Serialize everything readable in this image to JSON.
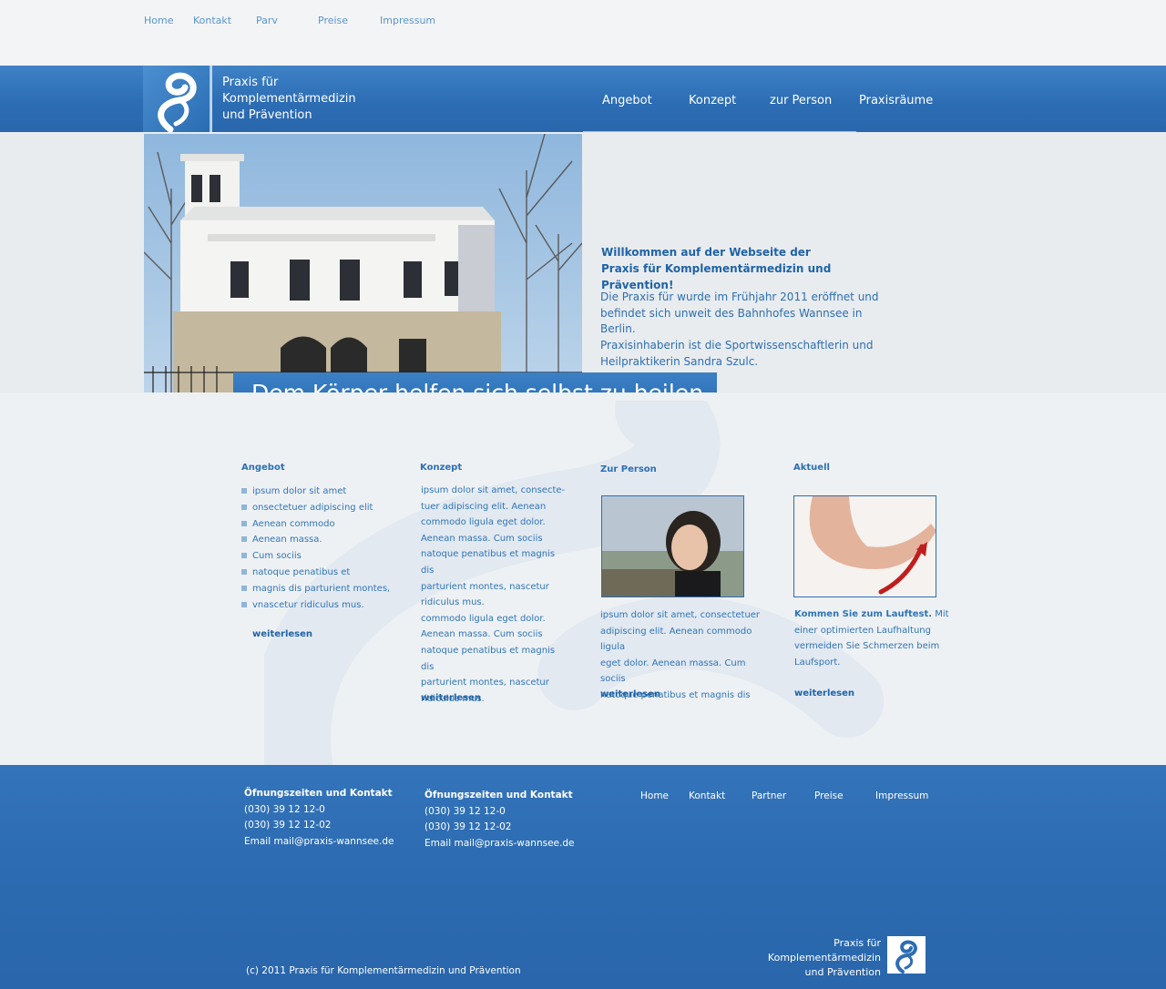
{
  "top_nav": [
    "Home",
    "Kontakt",
    "Parv",
    "Preise",
    "Impressum"
  ],
  "brand": {
    "line1": "Praxis für",
    "line2": "Komplementärmedizin",
    "line3": "und Prävention"
  },
  "main_nav": [
    "Angebot",
    "Konzept",
    "zur Person",
    "Praxisräume"
  ],
  "hero": {
    "tagline": "Dem Körper helfen sich selbst zu heilen.",
    "welcome_line1": "Willkommen auf der Webseite der",
    "welcome_line2": "Praxis für Komplementärmedizin und Prävention!",
    "body": [
      "Die Praxis für wurde im Frühjahr 2011 eröffnet und",
      "befindet sich unweit des Bahnhofes Wannsee in Berlin.",
      "Praxisinhaberin ist die Sportwissenschaftlerin und",
      "Heilpraktikerin Sandra Szulc."
    ]
  },
  "columns": {
    "angebot": {
      "title": "Angebot",
      "items": [
        "ipsum dolor sit amet",
        "onsectetuer adipiscing elit",
        "Aenean commodo",
        "Aenean massa.",
        "Cum sociis",
        "natoque penatibus et",
        "magnis dis parturient montes,",
        "vnascetur ridiculus mus."
      ],
      "more": "weiterlesen"
    },
    "konzept": {
      "title": "Konzept",
      "lines": [
        "ipsum dolor sit amet, consecte-",
        "tuer adipiscing elit. Aenean",
        "commodo ligula eget dolor.",
        "Aenean massa. Cum sociis",
        "natoque penatibus et magnis dis",
        "parturient montes, nascetur",
        "ridiculus mus.",
        "commodo ligula eget dolor.",
        "Aenean massa. Cum sociis",
        "natoque penatibus et magnis dis",
        "parturient montes, nascetur",
        "ridiculus mus."
      ],
      "more": "weiterlesen"
    },
    "person": {
      "title": "Zur Person",
      "lines": [
        "ipsum dolor sit amet, consectetuer",
        "adipiscing elit. Aenean commodo ligula",
        "eget dolor. Aenean massa. Cum sociis",
        "natoque penatibus et magnis dis"
      ],
      "more": "weiterlesen"
    },
    "aktuell": {
      "title": "Aktuell",
      "bold": "Kommen Sie zum Lauftest.",
      "rest_first": " Mit",
      "lines": [
        "einer optimierten Laufhaltung",
        "vermeiden Sie Schmerzen beim",
        "Laufsport."
      ],
      "more": "weiterlesen"
    }
  },
  "footer": {
    "contact_title": "Öfnungszeiten und Kontakt",
    "phone1": "(030) 39 12 12-0",
    "phone2": "(030) 39 12 12-02",
    "email": "Email mail@praxis-wannsee.de",
    "nav": [
      "Home",
      "Kontakt",
      "Partner",
      "Preise",
      "Impressum"
    ],
    "copyright": "(c) 2011 Praxis für Komplementärmedizin und Prävention"
  },
  "colors": {
    "brand_blue": "#2c6db4",
    "text_blue": "#2f74b8",
    "background": "#eef0f2"
  }
}
